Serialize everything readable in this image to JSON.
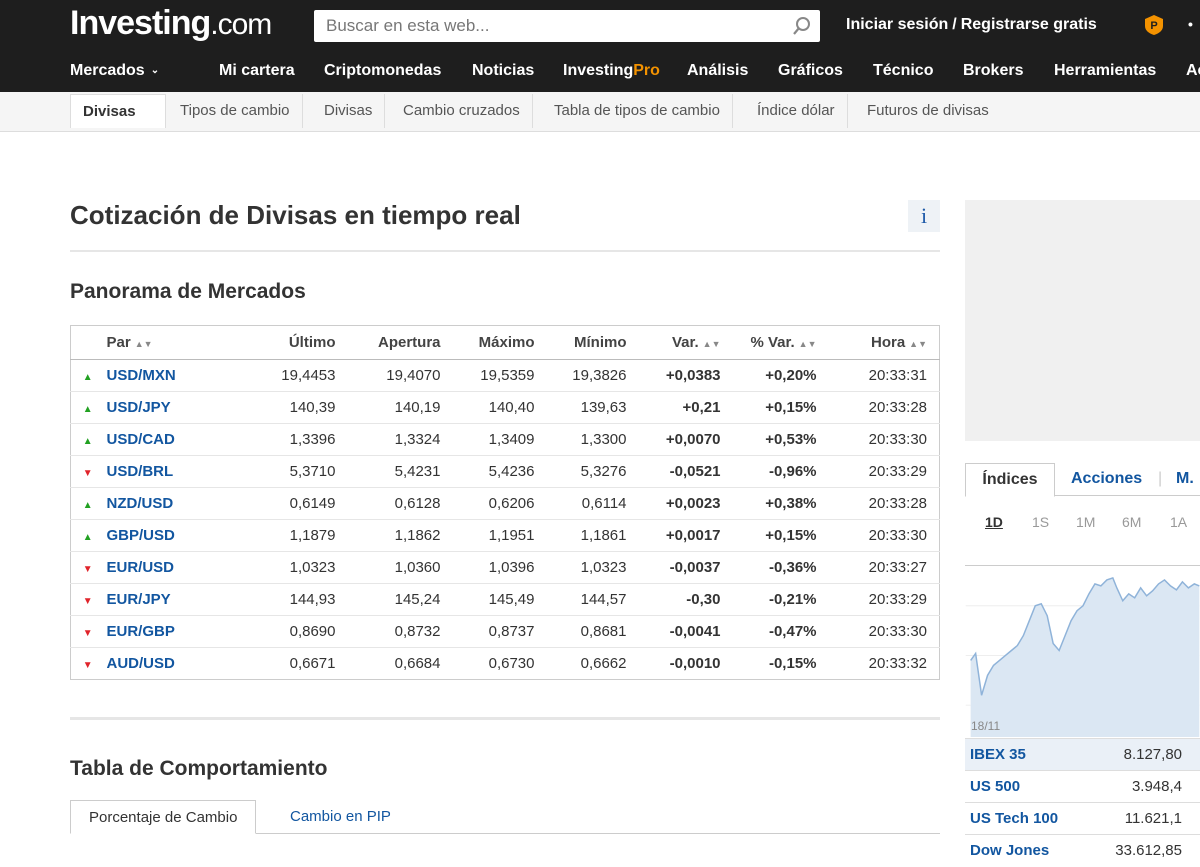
{
  "header": {
    "logo_main": "Investing",
    "logo_suffix": ".com",
    "search_placeholder": "Buscar en esta web...",
    "login": "Iniciar sesión",
    "register": "Registrarse gratis",
    "nav": [
      {
        "label": "Mercados"
      },
      {
        "label": "Mi cartera"
      },
      {
        "label": "Criptomonedas"
      },
      {
        "label": "Noticias"
      },
      {
        "label": "Investing",
        "suffix": "Pro"
      },
      {
        "label": "Análisis"
      },
      {
        "label": "Gráficos"
      },
      {
        "label": "Técnico"
      },
      {
        "label": "Brokers"
      },
      {
        "label": "Herramientas"
      },
      {
        "label": "Ac"
      }
    ]
  },
  "subnav": {
    "items": [
      "Divisas",
      "Tipos de cambio",
      "Divisas",
      "Cambio cruzados",
      "Tabla de tipos de cambio",
      "Índice dólar",
      "Futuros de divisas"
    ]
  },
  "page": {
    "title": "Cotización de Divisas en tiempo real",
    "info_label": "i",
    "overview_title": "Panorama de Mercados",
    "performance_title": "Tabla de Comportamiento",
    "performance_tabs": [
      "Porcentaje de Cambio",
      "Cambio en PIP"
    ]
  },
  "quotes": {
    "columns": [
      "Par",
      "Último",
      "Apertura",
      "Máximo",
      "Mínimo",
      "Var.",
      "% Var.",
      "Hora"
    ],
    "rows": [
      {
        "dir": "up",
        "pair": "USD/MXN",
        "last": "19,4453",
        "open": "19,4070",
        "high": "19,5359",
        "low": "19,3826",
        "chg": "+0,0383",
        "pct": "+0,20%",
        "time": "20:33:31"
      },
      {
        "dir": "up",
        "pair": "USD/JPY",
        "last": "140,39",
        "open": "140,19",
        "high": "140,40",
        "low": "139,63",
        "chg": "+0,21",
        "pct": "+0,15%",
        "time": "20:33:28"
      },
      {
        "dir": "up",
        "pair": "USD/CAD",
        "last": "1,3396",
        "open": "1,3324",
        "high": "1,3409",
        "low": "1,3300",
        "chg": "+0,0070",
        "pct": "+0,53%",
        "time": "20:33:30"
      },
      {
        "dir": "down",
        "pair": "USD/BRL",
        "last": "5,3710",
        "open": "5,4231",
        "high": "5,4236",
        "low": "5,3276",
        "chg": "-0,0521",
        "pct": "-0,96%",
        "time": "20:33:29"
      },
      {
        "dir": "up",
        "pair": "NZD/USD",
        "last": "0,6149",
        "open": "0,6128",
        "high": "0,6206",
        "low": "0,6114",
        "chg": "+0,0023",
        "pct": "+0,38%",
        "time": "20:33:28"
      },
      {
        "dir": "up",
        "pair": "GBP/USD",
        "last": "1,1879",
        "open": "1,1862",
        "high": "1,1951",
        "low": "1,1861",
        "chg": "+0,0017",
        "pct": "+0,15%",
        "time": "20:33:30"
      },
      {
        "dir": "down",
        "pair": "EUR/USD",
        "last": "1,0323",
        "open": "1,0360",
        "high": "1,0396",
        "low": "1,0323",
        "chg": "-0,0037",
        "pct": "-0,36%",
        "time": "20:33:27"
      },
      {
        "dir": "down",
        "pair": "EUR/JPY",
        "last": "144,93",
        "open": "145,24",
        "high": "145,49",
        "low": "144,57",
        "chg": "-0,30",
        "pct": "-0,21%",
        "time": "20:33:29"
      },
      {
        "dir": "down",
        "pair": "EUR/GBP",
        "last": "0,8690",
        "open": "0,8732",
        "high": "0,8737",
        "low": "0,8681",
        "chg": "-0,0041",
        "pct": "-0,47%",
        "time": "20:33:30"
      },
      {
        "dir": "down",
        "pair": "AUD/USD",
        "last": "0,6671",
        "open": "0,6684",
        "high": "0,6730",
        "low": "0,6662",
        "chg": "-0,0010",
        "pct": "-0,15%",
        "time": "20:33:32"
      }
    ]
  },
  "sidebar": {
    "tabs": [
      "Índices",
      "Acciones",
      "M."
    ],
    "periods": [
      "1D",
      "1S",
      "1M",
      "6M",
      "1A"
    ],
    "active_period": "1D",
    "chart_date_label": "18/11",
    "indices": [
      {
        "name": "IBEX 35",
        "value": "8.127,80"
      },
      {
        "name": "US 500",
        "value": "3.948,4"
      },
      {
        "name": "US Tech 100",
        "value": "11.621,1"
      },
      {
        "name": "Dow Jones",
        "value": "33.612,85"
      }
    ]
  },
  "colors": {
    "header_bg": "#1e1e1e",
    "link": "#1256a0",
    "positive": "#22a122",
    "negative": "#e0232a",
    "pro_accent": "#f39200"
  }
}
